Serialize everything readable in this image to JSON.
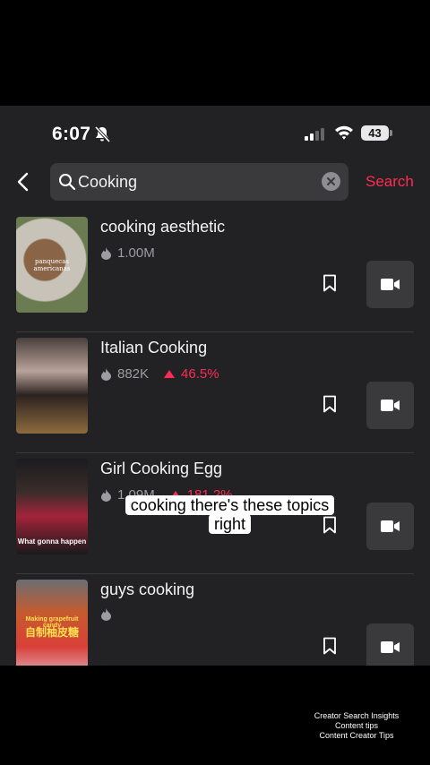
{
  "status_bar": {
    "time": "6:07",
    "battery": "43"
  },
  "search": {
    "query": "Cooking",
    "button_label": "Search"
  },
  "results": [
    {
      "title": "cooking aesthetic",
      "views": "1.00M",
      "trend": null,
      "thumb_text": "panquecas americanas"
    },
    {
      "title": "Italian Cooking",
      "views": "882K",
      "trend": "46.5%"
    },
    {
      "title": "Girl Cooking Egg",
      "views": "1.09M",
      "trend": "181.2%",
      "thumb_text": "What gonna happen"
    },
    {
      "title": "guys cooking",
      "views": "",
      "trend": null,
      "thumb_text": "Making grapefruit candy",
      "thumb_text2": "自制柚皮糖"
    }
  ],
  "caption": "cooking there's these topics right",
  "footer": {
    "line1": "Creator Search Insights",
    "line2": "Content tips",
    "line3": "Content Creator Tips"
  },
  "colors": {
    "accent": "#fe2c55",
    "background": "#222224",
    "surface": "#3a3a3c"
  }
}
